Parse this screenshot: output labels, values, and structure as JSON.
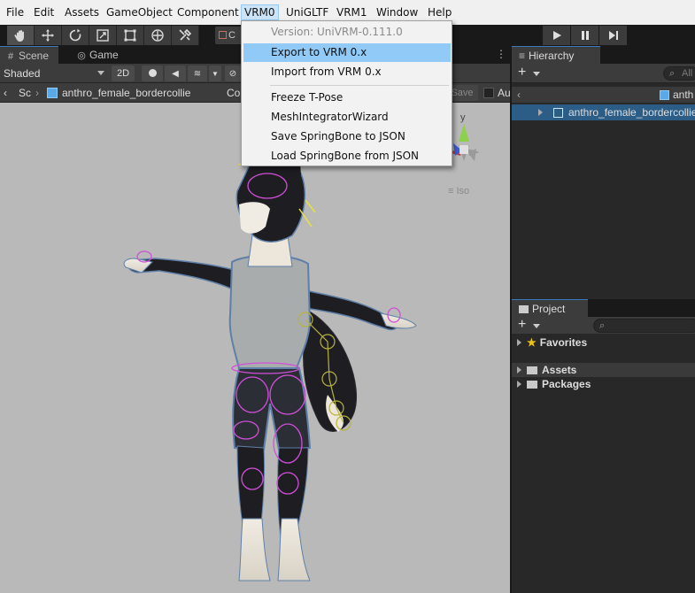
{
  "menubar": {
    "items": [
      "File",
      "Edit",
      "Assets",
      "GameObject",
      "Component",
      "VRM0",
      "UniGLTF",
      "VRM1",
      "Window",
      "Help"
    ]
  },
  "toolbar": {
    "snap_label": "C"
  },
  "vrm0_menu": {
    "version": "Version: UniVRM-0.111.0",
    "items": [
      "Export to VRM 0.x",
      "Import from VRM 0.x",
      "Freeze T-Pose",
      "MeshIntegratorWizard",
      "Save SpringBone to JSON",
      "Load SpringBone from JSON"
    ]
  },
  "scene": {
    "tabs": [
      "Scene",
      "Game"
    ],
    "shading": "Shaded",
    "mode_2d": "2D",
    "breadcrumb_root": "Sc",
    "breadcrumb_object": "anthro_female_bordercollie",
    "context_label": "Co",
    "save_label": "Save",
    "auto_label": "Au",
    "gizmo_axis": "y",
    "persp_label": "Iso"
  },
  "hierarchy": {
    "tab": "Hierarchy",
    "search": "All",
    "root": "anth",
    "selected": "anthro_female_bordercollie"
  },
  "project": {
    "tab": "Project",
    "favorites": "Favorites",
    "folders": [
      "Assets",
      "Packages"
    ]
  },
  "colors": {
    "menu_highlight": "#91c9f7",
    "selection": "#2c5d87",
    "accent": "#3a79bb"
  }
}
